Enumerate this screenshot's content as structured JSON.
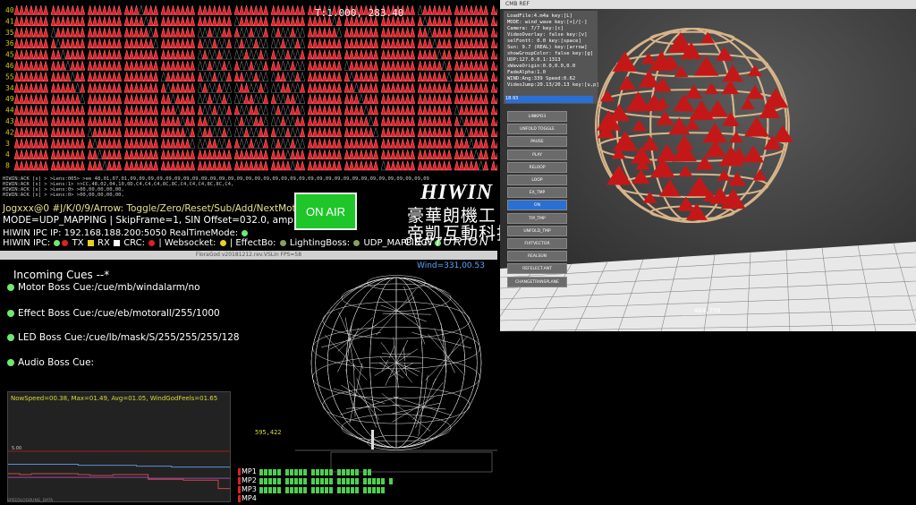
{
  "motor_panel": {
    "timecode": "T:1.000, 283.40",
    "row_labels": [
      "40",
      "41",
      "35",
      "36",
      "45",
      "46",
      "55",
      "34",
      "49",
      "44",
      "43",
      "42",
      "3",
      "4",
      "8"
    ],
    "log_lines": [
      "HIWIN:ACK  [s] > >Lens:005> >ee 48,01,07,01,09,09,09,09,09,09,09,09,09,09,09,09,09,09,09,09,09,09,09,09,09,09,09,09,09,09,09,09,09,09,09,09,09,09",
      "HIWIN:ACK  [s] > >Lens:1> >>CC,48,02,04,10,0D,C4,C4,C4,8C,8C,C4,C4,C4,8C,8C,C4,",
      "HIWIN:ACK  [s] > >Lens:0> >00,00,00,00,00,",
      "HIWIN:ACK  [s] > >Lens:0> >00,00,00,00,00,"
    ],
    "jog_text": "Jogxxx@0 #J/K/0/9/Arrow: Toggle/Zero/Reset/Sub/Add/NextMotor",
    "mode_text": "MODE=UDP_MAPPING  | SkipFrame=1, SIN Offset=032.0, amp=00.10",
    "ipc_ip_text": "HIWIN IPC IP: 192.168.188.200:5050 RealTimeMode:",
    "status": {
      "ipc_label": "HIWIN IPC:",
      "tx_label": "TX",
      "rx_label": "RX",
      "crc_label": "CRC:",
      "websocket_label": "| Websocket:",
      "effectbo_label": "| EffectBo:",
      "lightingboss_label": "LightingBoss:",
      "mode_label": "UDP_MAPPING:"
    },
    "on_air_label": "ON AIR",
    "logo": {
      "brand": "HIWIN",
      "cn_line1": "豪華朗機工",
      "cn_line2": "帝凱互動科技",
      "decade": "DECADE  Interactive  Solutions",
      "centurion": "CENTURION"
    },
    "colors": {
      "triangle_red": "#e8202a",
      "triangle_outline": "#888888",
      "on_air_green": "#1fc62a",
      "status_green": "#6fe86f"
    }
  },
  "window_title": "FloraGod v20181212.rev.VSLin FPS=58",
  "cues": {
    "wind_text": "Wind=331,00.53",
    "title": "Incoming Cues --*",
    "items": [
      {
        "label": "Motor Boss Cue:/cue/mb/windalarm/no"
      },
      {
        "label": "Effect Boss Cue:/cue/eb/motorall/255/1000"
      },
      {
        "label": "LED Boss Cue:/cue/lb/mask/S/255/255/255/128"
      },
      {
        "label": "Audio Boss Cue:"
      }
    ]
  },
  "speed_chart": {
    "label": "NowSpeed=00.38, Max=01.49, Avg=01.05, WindGodFeels=01.65",
    "threshold_label": "5.00",
    "footer": "SPEEDLOGBUNG_DATA"
  },
  "chart_data": {
    "type": "line",
    "title": "NowSpeed=00.38, Max=01.49, Avg=01.05, WindGodFeels=01.65",
    "xlabel": "",
    "ylabel": "",
    "ylim": [
      0,
      10
    ],
    "threshold": 5.0,
    "x": [
      0,
      1,
      2,
      3,
      4,
      5,
      6,
      7,
      8,
      9,
      10,
      11,
      12,
      13,
      14,
      15,
      16,
      17,
      18,
      19
    ],
    "series": [
      {
        "name": "",
        "color": "#5b8fd6",
        "values": [
          3.6,
          3.6,
          3.6,
          3.6,
          3.6,
          3.6,
          3.5,
          3.5,
          3.5,
          3.5,
          3.5,
          3.4,
          3.4,
          3.4,
          3.3,
          3.3,
          3.3,
          3.3,
          3.3,
          3.2
        ]
      },
      {
        "name": "",
        "color": "#c94a4a",
        "values": [
          2.6,
          2.5,
          2.6,
          2.6,
          2.6,
          2.6,
          2.5,
          2.4,
          2.4,
          2.5,
          2.5,
          2.5,
          2.0,
          2.0,
          2.0,
          1.9,
          1.9,
          1.9,
          1.0,
          1.0
        ]
      },
      {
        "name": "",
        "color": "#a04aa0",
        "values": [
          2.2,
          2.2,
          2.2,
          2.2,
          2.2,
          2.2,
          2.2,
          2.2,
          2.2,
          2.2,
          2.2,
          2.2,
          2.1,
          2.1,
          2.1,
          2.1,
          2.1,
          2.1,
          2.1,
          2.1
        ]
      }
    ],
    "grid": false
  },
  "sphere": {
    "coord_text": "595,422"
  },
  "mp_rows": [
    {
      "label": "MP1",
      "blocks": 22,
      "color": "#4ecf4e"
    },
    {
      "label": "MP2",
      "blocks": 26,
      "color": "#4ecf4e"
    },
    {
      "label": "MP3",
      "blocks": 25,
      "color": "#4ecf4e"
    },
    {
      "label": "MP4",
      "blocks": 0,
      "color": "#4ecf4e"
    }
  ],
  "view3d": {
    "title": "CMB REF",
    "coord_text": "464,750",
    "inspector_lines": [
      "LoadFile:4.m4a  key:[L]",
      "MODE: wind_wave  key:[+]/[-]",
      "Camera: 7/7  key:[c]",
      "VideoOverlay: false  key:[v]",
      "selFontt: 0.0  key:[space]",
      "Sun: 9.7 (REAL)  key:[arrow]",
      "showGroupColor: false  key:[g]",
      "UDP:127.0.0.1:1313",
      "xWaveOrigin:0.0,0.0,0.0",
      "FadeAlpha:1.0",
      "WIND:Ang:339 Speed:0.62",
      "VideoJump:20.13/20.13 key:[u,p]"
    ],
    "selected_field": "18.93",
    "buttons": [
      {
        "label": "LINKPO3",
        "active": false
      },
      {
        "label": "UNFOLD TOGGLE",
        "active": false
      },
      {
        "label": "PAUSE",
        "active": false
      },
      {
        "label": "PLAY",
        "active": false
      },
      {
        "label": "RELOOP",
        "active": false
      },
      {
        "label": "LOOP",
        "active": false
      },
      {
        "label": "EX_TMP",
        "active": false
      },
      {
        "label": "ON",
        "active": true
      },
      {
        "label": "TIP_TMP",
        "active": false
      },
      {
        "label": "UNFOLD_TMP",
        "active": false
      },
      {
        "label": "FIXTVECTOR",
        "active": false
      },
      {
        "label": "REALSUN",
        "active": false
      },
      {
        "label": "REFELECT.ANT",
        "active": false
      },
      {
        "label": "CHANGETRANSPLANE",
        "active": false
      }
    ]
  }
}
